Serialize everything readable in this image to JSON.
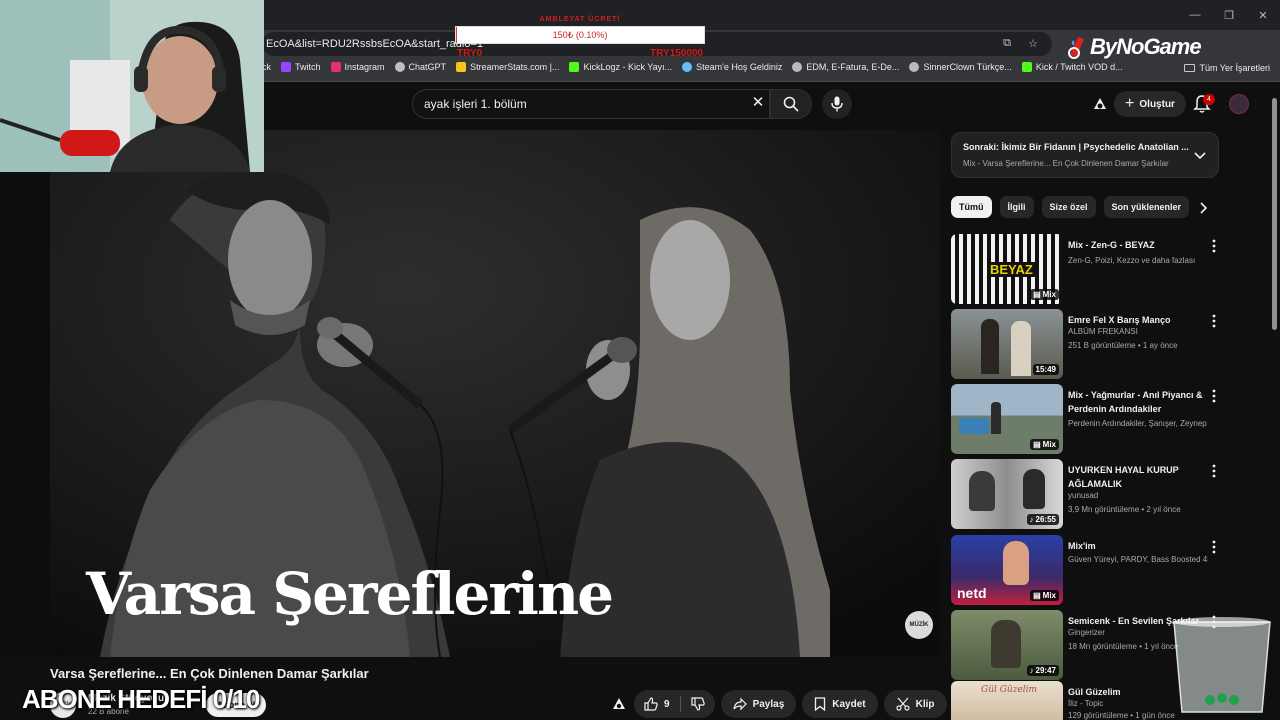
{
  "browser": {
    "url_partial": "EcOA&list=RDU2RssbsEcOA&start_radio=1",
    "bookmarks": [
      {
        "label": "Twitch",
        "color": "#9146ff"
      },
      {
        "label": "Instagram",
        "color": "#e1306c"
      },
      {
        "label": "ChatGPT",
        "color": "#c0c0c0"
      },
      {
        "label": "StreamerStats.com |...",
        "color": "#f5c518"
      },
      {
        "label": "KickLogz - Kick Yayı...",
        "color": "#53fc18"
      },
      {
        "label": "Steam'e Hoş Geldiniz",
        "color": "#66c0f4"
      },
      {
        "label": "EDM, E-Fatura, E-De...",
        "color": "#bbbbbb"
      },
      {
        "label": "SinnerClown Türkçe...",
        "color": "#bbbbbb"
      },
      {
        "label": "Kick / Twitch VOD d...",
        "color": "#53fc18"
      }
    ],
    "bookmarks_folder": "Tüm Yer İşaretleri",
    "bookmark_partial": "ck"
  },
  "overlay": {
    "goal_title": "AMBLEYAT ÜCRETİ",
    "goal_value": "150₺ (0.10%)",
    "goal_progress": 0.001,
    "goal_min": "TRY0",
    "goal_max": "TRY150000",
    "brand": "ByNoGame",
    "subscriber_goal": "ABONE HEDEFİ 0/10"
  },
  "header": {
    "search_query": "ayak işleri 1. bölüm",
    "create_label": "Oluştur",
    "notification_count": "4"
  },
  "video": {
    "overlay_text": "Varsa Şereflerine",
    "title": "Varsa Şereflerine... En Çok Dinlenen Damar Şarkılar",
    "channel_name": "Müzik Stüdyosu",
    "channel_subs": "22 B abone",
    "channel_badge": "MÜZİK",
    "subscribe_label": "Abone ol",
    "like_count": "9",
    "share_label": "Paylaş",
    "save_label": "Kaydet",
    "clip_label": "Klip"
  },
  "sidebar": {
    "next_title": "Sonraki: İkimiz Bir Fidanın | Psychedelic Anatolian ...",
    "next_sub": "Mix - Varsa Şereflerine...  En Çok Dinlenen Damar Şarkılar",
    "chips": [
      "Tümü",
      "İlgili",
      "Size özel",
      "Son yüklenenler"
    ],
    "recommendations": [
      {
        "title": "Mix - Zen-G - BEYAZ",
        "channel": "Zen-G, Poizi, Kezzo ve daha fazlası",
        "meta": "",
        "badge": "Mix",
        "thumb_text": "BEYAZ"
      },
      {
        "title": "Emre Fel X Barış Manço",
        "channel": "ALBÜM FREKANSI",
        "meta": "251 B görüntüleme • 1 ay önce",
        "badge": "15:49",
        "thumb_text": ""
      },
      {
        "title": "Mix - Yağmurlar - Anıl Piyancı & Perdenin Ardındakiler",
        "channel": "Perdenin Ardındakiler, Şanışer, Zeynep B...",
        "meta": "",
        "badge": "Mix",
        "thumb_text": ""
      },
      {
        "title": "UYURKEN HAYAL KURUP AĞLAMALIK",
        "channel": "yunusad",
        "meta": "3,9 Mn görüntüleme • 2 yıl önce",
        "badge": "26:55",
        "thumb_text": ""
      },
      {
        "title": "Mix'im",
        "channel": "Güven Yüreyi, PARDY, Bass Boosted 4K v...",
        "meta": "",
        "badge": "Mix",
        "thumb_text": "netd"
      },
      {
        "title": "Semicenk - En Sevilen Şarkılar",
        "channel": "Gingerizer",
        "meta": "18 Mn görüntüleme • 1 yıl önce",
        "badge": "29:47",
        "thumb_text": ""
      },
      {
        "title": "Gül Güzelim",
        "channel": "İliz - Topic",
        "meta": "129 görüntüleme • 1 gün önce",
        "badge": "",
        "thumb_text": "Gül Güzelim"
      }
    ]
  },
  "colors": {
    "background": "#0f0f0f",
    "chip_active": "#f1f1f1",
    "notification_badge": "#cc0000",
    "goal_red": "#d01818"
  }
}
